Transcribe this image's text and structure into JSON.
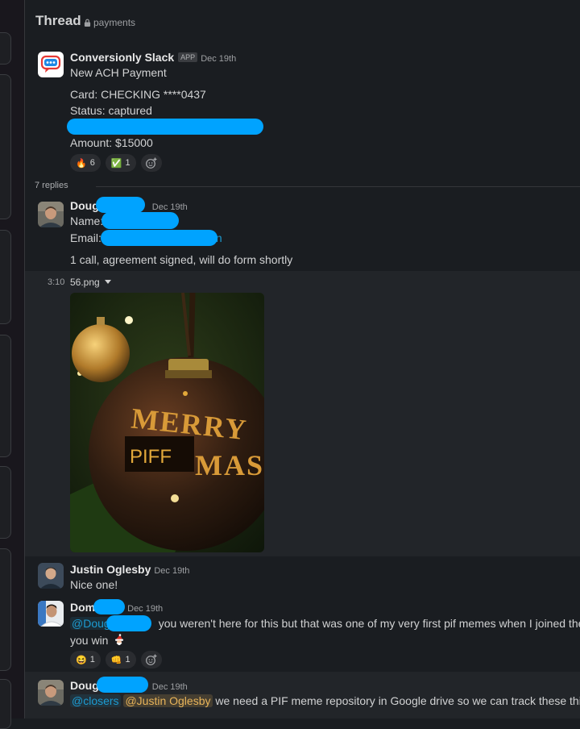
{
  "header": {
    "title": "Thread",
    "channel": "payments"
  },
  "parent_message": {
    "sender": "Conversionly Slack",
    "badge": "APP",
    "time": "Dec 19th",
    "title": "New ACH Payment",
    "card_line": "Card: CHECKING ****0437",
    "status_line": "Status: captured",
    "amount_line": "Amount: $15000",
    "reactions": [
      {
        "emoji": "🔥",
        "count": "6"
      },
      {
        "emoji": "✅",
        "count": "1"
      }
    ]
  },
  "replies_label": "7 replies",
  "reply1": {
    "sender": "Doug",
    "time": "Dec 19th",
    "name_label": "Name:",
    "email_label": "Email:",
    "email_tail": "n",
    "body": "1 call, agreement signed, will do form shortly"
  },
  "file": {
    "time": "3:10",
    "name": "56.png",
    "overlay_text": "PIFF"
  },
  "reply2": {
    "sender": "Justin Oglesby",
    "time": "Dec 19th",
    "body": "Nice one!"
  },
  "reply3": {
    "sender": "Dom",
    "time": "Dec 19th",
    "mention": "@Doug",
    "body": "you weren't here for this but that was one of my very first pif memes when I joined the tea",
    "body2": "you win",
    "reactions": [
      {
        "emoji": "😆",
        "count": "1"
      },
      {
        "emoji": "👊",
        "count": "1"
      }
    ]
  },
  "reply4": {
    "sender": "Doug",
    "time": "Dec 19th",
    "mention1": "@closers",
    "mention2": "@Justin Oglesby",
    "body": "we need a PIF meme repository in Google drive so we can track these things!"
  }
}
